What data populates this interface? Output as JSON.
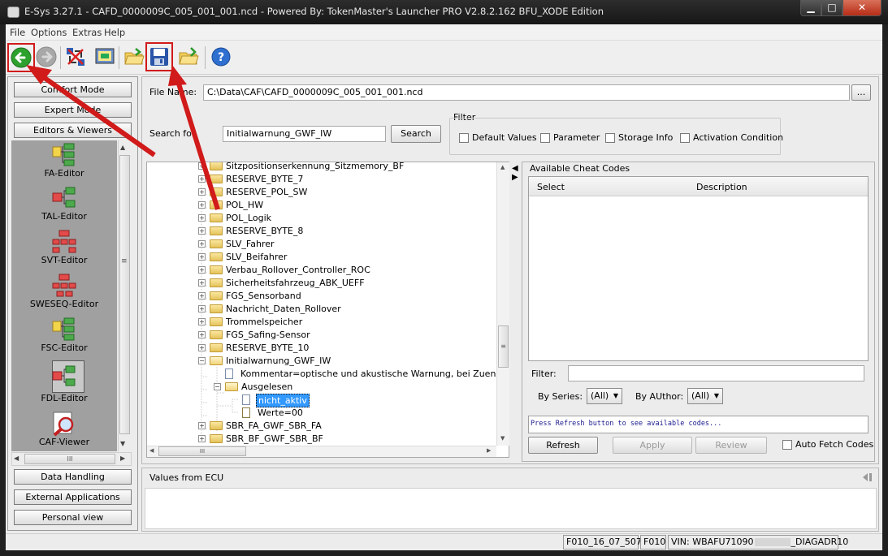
{
  "window": {
    "title": "E-Sys 3.27.1 - CAFD_0000009C_005_001_001.ncd - Powered By: TokenMaster's Launcher PRO V2.8.2.162 BFU_XODE Edition",
    "minimize": "▁",
    "maximize": "□",
    "close": "✕"
  },
  "menu": [
    "File",
    "Options",
    "Extras",
    "Help"
  ],
  "toolbar": {
    "icons": [
      "back-arrow-icon",
      "forward-arrow-icon",
      "connect-icon",
      "vehicle-order-icon",
      "open-folder-icon",
      "save-icon",
      "open-file-icon",
      "help-icon"
    ],
    "highlight_color": "#d11a1a"
  },
  "left": {
    "top_buttons": [
      "Comfort Mode",
      "Expert Mode",
      "Editors & Viewers"
    ],
    "editors": [
      "FA-Editor",
      "TAL-Editor",
      "SVT-Editor",
      "SWESEQ-Editor",
      "FSC-Editor",
      "FDL-Editor",
      "CAF-Viewer"
    ],
    "bottom_buttons": [
      "Data Handling",
      "External Applications",
      "Personal view"
    ],
    "hscroll_label": "III",
    "vscroll_grip": "≡"
  },
  "main": {
    "file_name_label": "File Name:",
    "file_name_value": "C:\\Data\\CAF\\CAFD_0000009C_005_001_001.ncd",
    "browse_label": "...",
    "search_label": "Search for",
    "search_value": "Initialwarnung_GWF_IW",
    "search_button": "Search",
    "filter_title": "Filter",
    "filters": [
      "Default Values",
      "Parameter",
      "Storage Info",
      "Activation Condition"
    ],
    "tree": [
      {
        "label": "Sitzpositionserkennung_Sitzmemory_BF",
        "type": "folder"
      },
      {
        "label": "RESERVE_BYTE_7",
        "type": "folder"
      },
      {
        "label": "RESERVE_POL_SW",
        "type": "folder"
      },
      {
        "label": "POL_HW",
        "type": "folder"
      },
      {
        "label": "POL_Logik",
        "type": "folder"
      },
      {
        "label": "RESERVE_BYTE_8",
        "type": "folder"
      },
      {
        "label": "SLV_Fahrer",
        "type": "folder"
      },
      {
        "label": "SLV_Beifahrer",
        "type": "folder"
      },
      {
        "label": "Verbau_Rollover_Controller_ROC",
        "type": "folder"
      },
      {
        "label": "Sicherheitsfahrzeug_ABK_UEFF",
        "type": "folder"
      },
      {
        "label": "FGS_Sensorband",
        "type": "folder"
      },
      {
        "label": "Nachricht_Daten_Rollover",
        "type": "folder"
      },
      {
        "label": "Trommelspeicher",
        "type": "folder"
      },
      {
        "label": "FGS_Safing-Sensor",
        "type": "folder"
      },
      {
        "label": "RESERVE_BYTE_10",
        "type": "folder"
      },
      {
        "label": "Initialwarnung_GWF_IW",
        "type": "open-folder"
      },
      {
        "label": "Kommentar=optische und akustische Warnung, bei Zuendung ein,",
        "type": "doc"
      },
      {
        "label": "Ausgelesen",
        "type": "open-folder"
      },
      {
        "label": "nicht_aktiv",
        "type": "doc-selected"
      },
      {
        "label": "Werte=00",
        "type": "value"
      },
      {
        "label": "SBR_FA_GWF_SBR_FA",
        "type": "folder"
      },
      {
        "label": "SBR_BF_GWF_SBR_BF",
        "type": "folder"
      }
    ],
    "tree_hscroll_label": "III",
    "tree_vscroll_grip": "≡"
  },
  "cheat": {
    "title": "Available Cheat Codes",
    "col_select": "Select",
    "col_description": "Description",
    "filter_label": "Filter:",
    "by_series_label": "By Series:",
    "by_series_value": "(All)",
    "by_author_label": "By AUthor:",
    "by_author_value": "(All)",
    "status_text": "Press Refresh button to see available codes...",
    "refresh": "Refresh",
    "apply": "Apply",
    "review": "Review",
    "auto_fetch": "Auto Fetch Codes"
  },
  "ecu": {
    "title": "Values from ECU"
  },
  "status": {
    "cell1": "F010_16_07_507",
    "cell2": "F010",
    "cell3": "VIN: WBAFU71090",
    "cell4": "_DIAGADR10"
  }
}
